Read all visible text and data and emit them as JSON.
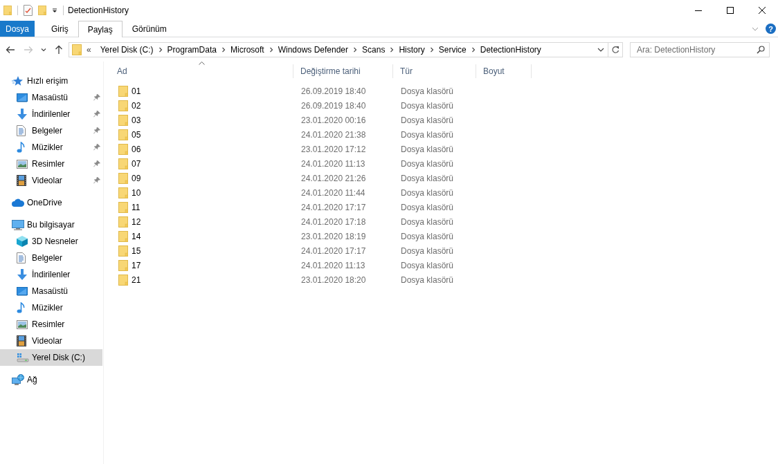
{
  "window": {
    "title": "DetectionHistory"
  },
  "ribbon": {
    "tabs": [
      {
        "label": "Dosya",
        "kind": "file"
      },
      {
        "label": "Giriş",
        "kind": "tab",
        "selected": false
      },
      {
        "label": "Paylaş",
        "kind": "tab",
        "selected": true
      },
      {
        "label": "Görünüm",
        "kind": "tab",
        "selected": false
      }
    ],
    "help": "?"
  },
  "navigation": {
    "buttons": [
      {
        "kind": "back",
        "disabled": false
      },
      {
        "kind": "forward",
        "disabled": true
      },
      {
        "kind": "recent",
        "disabled": false
      },
      {
        "kind": "up",
        "disabled": false
      }
    ]
  },
  "address_bar": {
    "overflow": "«",
    "breadcrumbs": [
      "Yerel Disk (C:)",
      "ProgramData",
      "Microsoft",
      "Windows Defender",
      "Scans",
      "History",
      "Service",
      "DetectionHistory"
    ]
  },
  "search": {
    "placeholder": "Ara: DetectionHistory"
  },
  "nav_pane": {
    "groups": [
      {
        "label": "Hızlı erişim",
        "kind": "quick",
        "selected": false,
        "children": [
          {
            "label": "Masaüstü",
            "kind": "desktop",
            "selected": false,
            "pinned": true
          },
          {
            "label": "İndirilenler",
            "kind": "downloads",
            "selected": false,
            "pinned": true
          },
          {
            "label": "Belgeler",
            "kind": "documents",
            "selected": false,
            "pinned": true
          },
          {
            "label": "Müzikler",
            "kind": "music",
            "selected": false,
            "pinned": true
          },
          {
            "label": "Resimler",
            "kind": "pictures",
            "selected": false,
            "pinned": true
          },
          {
            "label": "Videolar",
            "kind": "videos",
            "selected": false,
            "pinned": true
          }
        ]
      },
      {
        "label": "OneDrive",
        "kind": "cloud",
        "selected": false
      },
      {
        "label": "Bu bilgisayar",
        "kind": "pc",
        "selected": false,
        "children": [
          {
            "label": "3D Nesneler",
            "kind": "objects3d",
            "selected": false,
            "pinned": false
          },
          {
            "label": "Belgeler",
            "kind": "documents",
            "selected": false,
            "pinned": false
          },
          {
            "label": "İndirilenler",
            "kind": "downloads",
            "selected": false,
            "pinned": false
          },
          {
            "label": "Masaüstü",
            "kind": "desktop",
            "selected": false,
            "pinned": false
          },
          {
            "label": "Müzikler",
            "kind": "music",
            "selected": false,
            "pinned": false
          },
          {
            "label": "Resimler",
            "kind": "pictures",
            "selected": false,
            "pinned": false
          },
          {
            "label": "Videolar",
            "kind": "videos",
            "selected": false,
            "pinned": false
          },
          {
            "label": "Yerel Disk (C:)",
            "kind": "drive",
            "selected": true,
            "pinned": false
          }
        ]
      },
      {
        "label": "Ağ",
        "kind": "network",
        "selected": false
      }
    ]
  },
  "file_list": {
    "columns": [
      {
        "label": "Ad",
        "sorted": true
      },
      {
        "label": "Değiştirme tarihi",
        "sorted": false
      },
      {
        "label": "Tür",
        "sorted": false
      },
      {
        "label": "Boyut",
        "sorted": false
      }
    ],
    "rows": [
      {
        "name": "01",
        "modified": "26.09.2019 18:40",
        "type": "Dosya klasörü"
      },
      {
        "name": "02",
        "modified": "26.09.2019 18:40",
        "type": "Dosya klasörü"
      },
      {
        "name": "03",
        "modified": "23.01.2020 00:16",
        "type": "Dosya klasörü"
      },
      {
        "name": "05",
        "modified": "24.01.2020 21:38",
        "type": "Dosya klasörü"
      },
      {
        "name": "06",
        "modified": "23.01.2020 17:12",
        "type": "Dosya klasörü"
      },
      {
        "name": "07",
        "modified": "24.01.2020 11:13",
        "type": "Dosya klasörü"
      },
      {
        "name": "09",
        "modified": "24.01.2020 21:26",
        "type": "Dosya klasörü"
      },
      {
        "name": "10",
        "modified": "24.01.2020 11:44",
        "type": "Dosya klasörü"
      },
      {
        "name": "11",
        "modified": "24.01.2020 17:17",
        "type": "Dosya klasörü"
      },
      {
        "name": "12",
        "modified": "24.01.2020 17:18",
        "type": "Dosya klasörü"
      },
      {
        "name": "14",
        "modified": "23.01.2020 18:19",
        "type": "Dosya klasörü"
      },
      {
        "name": "15",
        "modified": "24.01.2020 17:17",
        "type": "Dosya klasörü"
      },
      {
        "name": "17",
        "modified": "24.01.2020 11:13",
        "type": "Dosya klasörü"
      },
      {
        "name": "21",
        "modified": "23.01.2020 18:20",
        "type": "Dosya klasörü"
      }
    ]
  }
}
